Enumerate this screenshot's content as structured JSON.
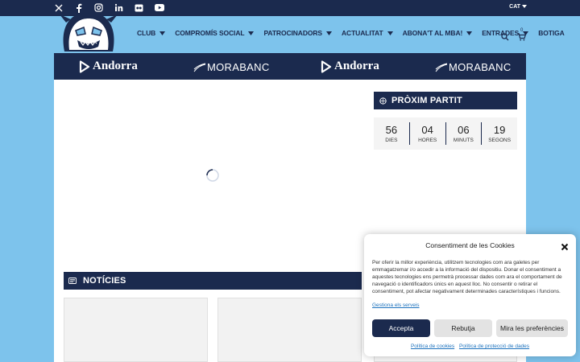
{
  "topbar": {
    "social_icons": [
      "x-icon",
      "facebook-icon",
      "instagram-icon",
      "linkedin-icon",
      "flickr-icon",
      "youtube-icon"
    ],
    "language": "CAT"
  },
  "nav": {
    "items": [
      {
        "label": "CLUB",
        "dropdown": true
      },
      {
        "label": "COMPROMÍS SOCIAL",
        "dropdown": true
      },
      {
        "label": "PATROCINADORS",
        "dropdown": true
      },
      {
        "label": "ACTUALITAT",
        "dropdown": true
      },
      {
        "label": "ABONA'T AL MBA!",
        "dropdown": true
      },
      {
        "label": "ENTRADES",
        "dropdown": true
      },
      {
        "label": "BOTIGA",
        "dropdown": false
      }
    ],
    "cart_count": "0"
  },
  "sponsors": [
    "Andorra",
    "MORABANC",
    "Andorra",
    "MORABANC"
  ],
  "next_match": {
    "title": "PRÒXIM PARTIT",
    "countdown": [
      {
        "value": "56",
        "label": "DIES"
      },
      {
        "value": "04",
        "label": "HORES"
      },
      {
        "value": "06",
        "label": "MINUTS"
      },
      {
        "value": "19",
        "label": "SEGONS"
      }
    ]
  },
  "news": {
    "title": "NOTÍCIES"
  },
  "cookie": {
    "title": "Consentiment de les Cookies",
    "text": "Per oferir la millor experiència, utilitzem tecnologies com ara galetes per emmagatzemar i/o accedir a la informació del dispositiu. Donar el consentiment a aquestes tecnologies ens permetrà processar dades com ara el comportament de navegació o identificadors únics en aquest lloc. No consentir o retirar el consentiment, pot afectar negativament determinades característiques i funcions.",
    "manage": "Gestiona els serveis",
    "accept": "Accepta",
    "reject": "Rebutja",
    "prefs": "Mira les preferències",
    "link_cookies": "Política de cookies",
    "link_privacy": "Política de protecció de dades"
  },
  "colors": {
    "navy": "#1b2a4e",
    "sky": "#7dc3ec",
    "link": "#1e73be"
  }
}
